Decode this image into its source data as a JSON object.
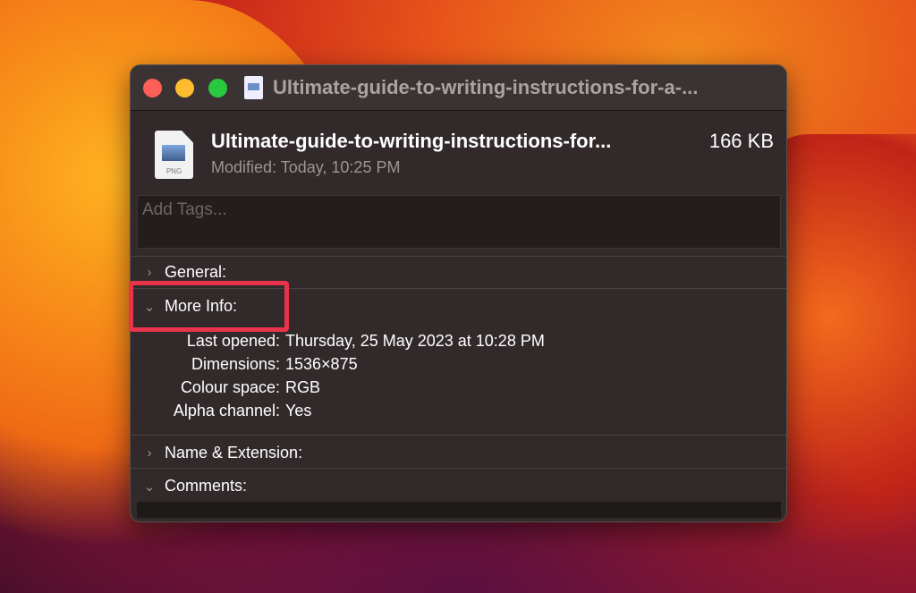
{
  "window": {
    "title": "Ultimate-guide-to-writing-instructions-for-a-...",
    "colors": {
      "close": "#fe5f57",
      "minimize": "#febc2e",
      "zoom": "#28c840",
      "highlight": "#e8334a"
    }
  },
  "file": {
    "name": "Ultimate-guide-to-writing-instructions-for...",
    "size": "166 KB",
    "modified": "Modified: Today, 10:25 PM",
    "icon_label": "PNG"
  },
  "tags": {
    "placeholder": "Add Tags..."
  },
  "sections": {
    "general": "General:",
    "more_info": "More Info:",
    "name_ext": "Name & Extension:",
    "comments": "Comments:"
  },
  "more_info": [
    {
      "label": "Last opened:",
      "value": "Thursday, 25 May 2023 at 10:28 PM"
    },
    {
      "label": "Dimensions:",
      "value": "1536×875"
    },
    {
      "label": "Colour space:",
      "value": "RGB"
    },
    {
      "label": "Alpha channel:",
      "value": "Yes"
    }
  ]
}
